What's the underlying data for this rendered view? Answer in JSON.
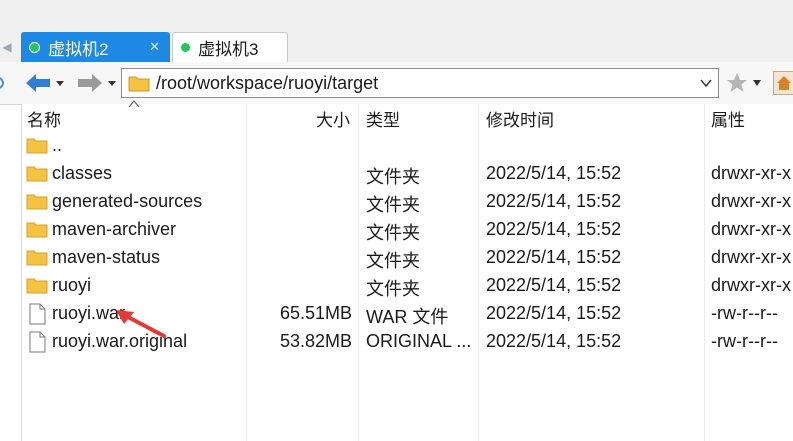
{
  "tabs": [
    {
      "label": "虚拟机2",
      "active": true,
      "status_color": "#22c55e"
    },
    {
      "label": "虚拟机3",
      "active": false,
      "status_color": "#22c55e"
    }
  ],
  "address": {
    "path": "/root/workspace/ruoyi/target"
  },
  "columns": {
    "name": "名称",
    "size": "大小",
    "type": "类型",
    "modified": "修改时间",
    "attributes": "属性"
  },
  "files": [
    {
      "name": "..",
      "size": "",
      "type": "",
      "modified": "",
      "attributes": "",
      "icon": "folder-icon"
    },
    {
      "name": "classes",
      "size": "",
      "type": "文件夹",
      "modified": "2022/5/14, 15:52",
      "attributes": "drwxr-xr-x",
      "icon": "folder-icon"
    },
    {
      "name": "generated-sources",
      "size": "",
      "type": "文件夹",
      "modified": "2022/5/14, 15:52",
      "attributes": "drwxr-xr-x",
      "icon": "folder-icon"
    },
    {
      "name": "maven-archiver",
      "size": "",
      "type": "文件夹",
      "modified": "2022/5/14, 15:52",
      "attributes": "drwxr-xr-x",
      "icon": "folder-icon"
    },
    {
      "name": "maven-status",
      "size": "",
      "type": "文件夹",
      "modified": "2022/5/14, 15:52",
      "attributes": "drwxr-xr-x",
      "icon": "folder-icon"
    },
    {
      "name": "ruoyi",
      "size": "",
      "type": "文件夹",
      "modified": "2022/5/14, 15:52",
      "attributes": "drwxr-xr-x",
      "icon": "folder-icon"
    },
    {
      "name": "ruoyi.war",
      "size": "65.51MB",
      "type": "WAR 文件",
      "modified": "2022/5/14, 15:52",
      "attributes": "-rw-r--r--",
      "icon": "file-icon"
    },
    {
      "name": "ruoyi.war.original",
      "size": "53.82MB",
      "type": "ORIGINAL ...",
      "modified": "2022/5/14, 15:52",
      "attributes": "-rw-r--r--",
      "icon": "file-icon"
    }
  ],
  "colors": {
    "accent": "#1e88e5",
    "folder": "#f5c242",
    "annotation_arrow": "#e53935"
  }
}
